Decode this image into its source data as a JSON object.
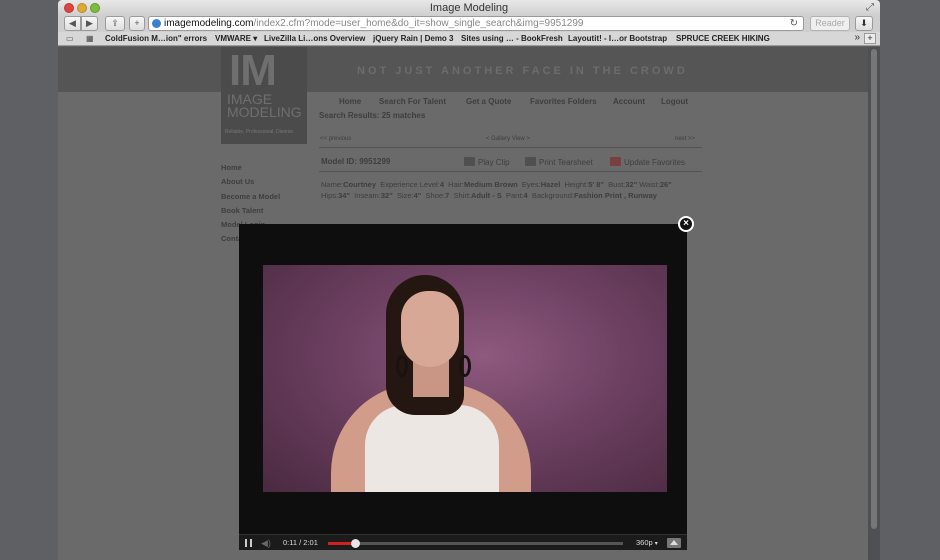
{
  "window": {
    "title": "Image Modeling"
  },
  "toolbar": {
    "url_host": "imagemodeling.com",
    "url_path": "/index2.cfm?mode=user_home&do_it=show_single_search&img=9951299",
    "reader_label": "Reader"
  },
  "bookmarks": [
    "ColdFusion M…ion\" errors",
    "VMWARE ▾",
    "LiveZilla Li…ons Overview",
    "jQuery Rain | Demo 3",
    "Sites using … - BookFresh",
    "Layoutit! - I…or Bootstrap",
    "SPRUCE CREEK HIKING"
  ],
  "site": {
    "tagline": "NOT JUST ANOTHER FACE IN THE CROWD",
    "logo_mark": "IM",
    "logo_line1": "IMAGE",
    "logo_line2": "MODELING",
    "logo_sub": "Reliable. Professional. Diverse.",
    "nav": [
      "Home",
      "Search For Talent",
      "Get a Quote",
      "Favorites Folders",
      "Account",
      "Logout"
    ],
    "results": "Search Results: 25 matches",
    "pager": {
      "previous": "<< previous",
      "gallery": "< Gallery View >",
      "next": "next >>"
    },
    "model_id": "Model ID: 9951299",
    "actions": {
      "play": "Play Clip",
      "print": "Print Tearsheet",
      "favorites": "Update Favorites"
    },
    "details": {
      "name_label": "Name:",
      "name": "Courtney",
      "exp_label": "Experience Level:",
      "exp": "4",
      "hair_label": "Hair:",
      "hair": "Medium Brown",
      "eyes_label": "Eyes:",
      "eyes": "Hazel",
      "height_label": "Height:",
      "height": "5' 8\"",
      "bust_label": "Bust:",
      "bust": "32\"",
      "waist_label": "Waist:",
      "waist": "26\"",
      "hips_label": "Hips:",
      "hips": "34\"",
      "inseam_label": "Inseam:",
      "inseam": "32\"",
      "size_label": "Size:",
      "size": "4\"",
      "shoe_label": "Shoe:",
      "shoe": "7",
      "shirt_label": "Shirt:",
      "shirt": "Adult - S",
      "pant_label": "Pant:",
      "pant": "4",
      "bg_label": "Background:",
      "bg": "Fashion Print , Runway"
    },
    "sidenav": [
      "Home",
      "About Us",
      "Become a Model",
      "Book Talent",
      "Model Login",
      "Contact"
    ]
  },
  "player": {
    "time": "0:11 / 2:01",
    "progress": 0.09,
    "quality": "360p",
    "close_label": "×"
  }
}
